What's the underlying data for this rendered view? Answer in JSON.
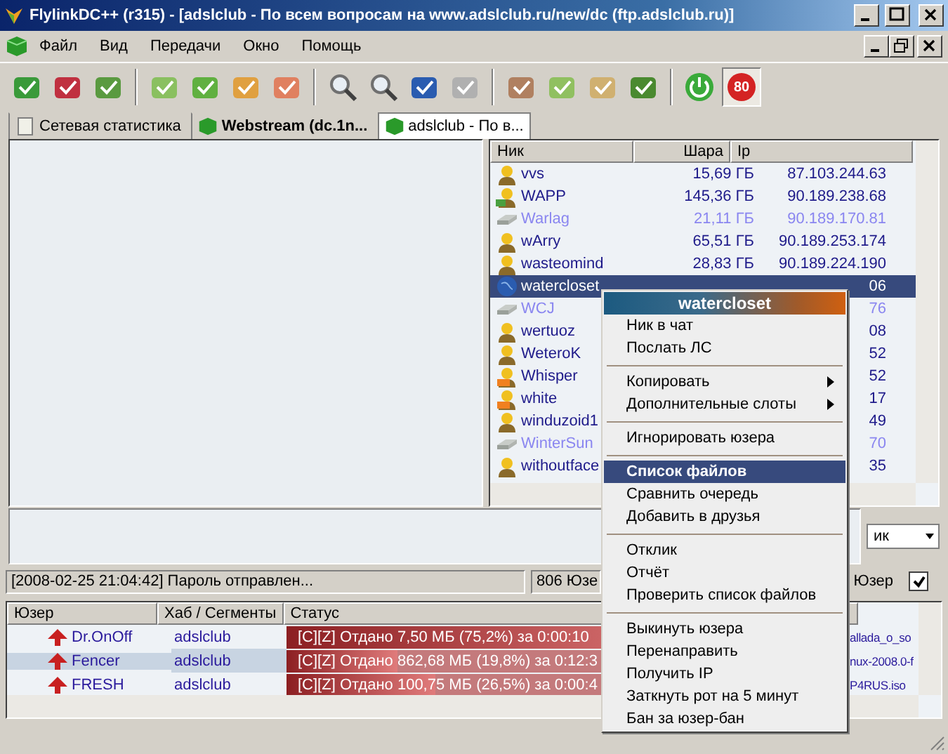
{
  "window": {
    "title": "FlylinkDC++ (r315) - [adslclub -  По всем вопросам на www.adslclub.ru/new/dc (ftp.adslclub.ru)]"
  },
  "menu": [
    "Файл",
    "Вид",
    "Передачи",
    "Окно",
    "Помощь"
  ],
  "toolbar": {
    "limit_badge": "80"
  },
  "tabs": [
    {
      "label": "Сетевая статистика",
      "selected": false,
      "unread": false,
      "kind": "stats"
    },
    {
      "label": "Webstream (dc.1n...",
      "selected": false,
      "unread": true,
      "kind": "hub"
    },
    {
      "label": "adslclub -  По в...",
      "selected": true,
      "unread": false,
      "kind": "hub"
    }
  ],
  "user_list": {
    "columns": [
      "Ник",
      "Шара",
      "Ip"
    ],
    "rows": [
      {
        "nick": "vvs",
        "share": "15,69 ГБ",
        "ip": "87.103.244.63",
        "kind": "user",
        "selected": false
      },
      {
        "nick": "WAPP",
        "share": "145,36 ГБ",
        "ip": "90.189.238.68",
        "kind": "op",
        "selected": false
      },
      {
        "nick": "Warlag",
        "share": "21,11 ГБ",
        "ip": "90.189.170.81",
        "kind": "passive",
        "selected": false
      },
      {
        "nick": "wArry",
        "share": "65,51 ГБ",
        "ip": "90.189.253.174",
        "kind": "user",
        "selected": false
      },
      {
        "nick": "wasteomind",
        "share": "28,83 ГБ",
        "ip": "90.189.224.190",
        "kind": "user",
        "selected": false
      },
      {
        "nick": "watercloset",
        "ip": "06",
        "kind": "globe",
        "selected": true
      },
      {
        "nick": "WCJ",
        "ip": "76",
        "kind": "passive",
        "selected": false
      },
      {
        "nick": "wertuoz",
        "ip": "08",
        "kind": "user",
        "selected": false
      },
      {
        "nick": "WeteroK",
        "ip": "52",
        "kind": "user",
        "selected": false
      },
      {
        "nick": "Whisper",
        "ip": "52",
        "kind": "away",
        "selected": false
      },
      {
        "nick": "white",
        "ip": "17",
        "kind": "away",
        "selected": false
      },
      {
        "nick": "winduzoid1",
        "ip": "49",
        "kind": "user",
        "selected": false
      },
      {
        "nick": "WinterSun",
        "ip": "70",
        "kind": "passive",
        "selected": false
      },
      {
        "nick": "withoutface",
        "ip": "35",
        "kind": "user",
        "selected": false
      }
    ]
  },
  "chat_input": {
    "nick_select": "ик"
  },
  "status": {
    "message": "[2008-02-25 21:04:42] Пароль отправлен...",
    "users": "806 Юзе",
    "filter_label": "Юзер",
    "filter_checked": true
  },
  "transfers": {
    "columns": [
      "Юзер",
      "Хаб / Сегменты",
      "Статус"
    ],
    "rows": [
      {
        "user": "Dr.OnOff",
        "hub": "adslclub",
        "status": "[C][Z] Отдано 7,50 МБ (75,2%) за 0:00:10",
        "level": 0.752,
        "file": "allada_o_so",
        "selected": false
      },
      {
        "user": "Fencer",
        "hub": "adslclub",
        "status": "[C][Z] Отдано 862,68 МБ (19,8%) за 0:12:3",
        "level": 0.198,
        "file": "nux-2008.0-f",
        "selected": true
      },
      {
        "user": "FRESH",
        "hub": "adslclub",
        "status": "[C][Z] Отдано 100,75 МБ (26,5%) за 0:00:4",
        "level": 0.265,
        "file": "P4RUS.iso",
        "selected": false
      }
    ]
  },
  "context_menu": {
    "title": "watercloset",
    "items": [
      {
        "kind": "item",
        "label": "Ник в чат",
        "selected": false
      },
      {
        "kind": "item",
        "label": "Послать ЛС",
        "selected": false
      },
      {
        "kind": "separator"
      },
      {
        "kind": "submenu",
        "label": "Копировать",
        "selected": false
      },
      {
        "kind": "submenu",
        "label": "Дополнительные слоты",
        "selected": false
      },
      {
        "kind": "separator"
      },
      {
        "kind": "item",
        "label": "Игнорировать юзера",
        "selected": false
      },
      {
        "kind": "separator"
      },
      {
        "kind": "item",
        "label": "Список файлов",
        "selected": true
      },
      {
        "kind": "item",
        "label": "Сравнить очередь",
        "selected": false
      },
      {
        "kind": "item",
        "label": "Добавить в друзья",
        "selected": false
      },
      {
        "kind": "separator"
      },
      {
        "kind": "item",
        "label": "Отклик",
        "selected": false
      },
      {
        "kind": "item",
        "label": "Отчёт",
        "selected": false
      },
      {
        "kind": "item",
        "label": "Проверить список файлов",
        "selected": false
      },
      {
        "kind": "separator"
      },
      {
        "kind": "item",
        "label": "Выкинуть юзера",
        "selected": false
      },
      {
        "kind": "item",
        "label": "Перенаправить",
        "selected": false
      },
      {
        "kind": "item",
        "label": "Получить IP",
        "selected": false
      },
      {
        "kind": "item",
        "label": "Заткнуть рот на 5 минут",
        "selected": false
      },
      {
        "kind": "item",
        "label": "Бан за юзер-бан",
        "selected": false
      }
    ]
  }
}
